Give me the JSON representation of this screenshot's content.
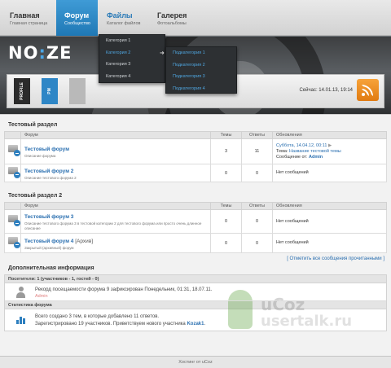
{
  "nav": {
    "items": [
      {
        "title": "Главная",
        "subtitle": "Главная страница"
      },
      {
        "title": "Форум",
        "subtitle": "Сообщество"
      },
      {
        "title": "Файлы",
        "subtitle": "Каталог файлов"
      },
      {
        "title": "Галерея",
        "subtitle": "Фотоальбомы"
      }
    ],
    "categories": [
      "Категория 1",
      "Категория 2",
      "Категория 3",
      "Категория 4"
    ],
    "subcategories": [
      "Подкатегория 1",
      "Подкатегория 2",
      "Подкатегория 3",
      "Подкатегория 4"
    ]
  },
  "header": {
    "logo_left": "NO",
    "logo_mid": ":",
    "logo_right": "ZE",
    "buttons": [
      "PROFILE",
      "PM",
      ""
    ],
    "clock": "Сейчас: 14.01.13, 19:14"
  },
  "forum_sections": [
    {
      "title": "Тестовый раздел",
      "headers": {
        "forum": "Форум",
        "topics": "Темы",
        "replies": "Ответы",
        "updates": "Обновления"
      },
      "rows": [
        {
          "name": "Тестовый форум",
          "desc": "Описание форума",
          "topics": "3",
          "replies": "11",
          "upd_date": "Суббота, 14.04.12, 00:11",
          "upd_topic_label": "Тема:",
          "upd_topic": "Название тестовой темы",
          "upd_by_label": "Сообщение от:",
          "upd_by": "Admin"
        },
        {
          "name": "Тестовый форум 2",
          "desc": "Описание тестового форума 2",
          "topics": "0",
          "replies": "0",
          "no_msgs": "Нет сообщений"
        }
      ]
    },
    {
      "title": "Тестовый раздел 2",
      "headers": {
        "forum": "Форум",
        "topics": "Темы",
        "replies": "Ответы",
        "updates": "Обновления"
      },
      "rows": [
        {
          "name": "Тестовый форум 3",
          "desc": "Описание тестового форума 3 в тестовой категории 2 для тестового форума или просто очень длинное описание",
          "topics": "0",
          "replies": "0",
          "no_msgs": "Нет сообщений"
        },
        {
          "name": "Тестовый форум 4",
          "archive": "[Архив]",
          "desc": "Закрытый (архивный) форум",
          "topics": "0",
          "replies": "0",
          "no_msgs": "Нет сообщений"
        }
      ]
    }
  ],
  "mark_read": "[ Отметить все сообщения прочитанными ]",
  "info": {
    "title": "Дополнительная информация",
    "visitors": "Посетители: 1  (участников - 1, гостей - 0)",
    "record": "Рекорд посещаемости форума 9 зафиксирован Понедельник, 01:31, 18.07.11.",
    "online_user": "Admin",
    "stats_title": "Статистика форума",
    "stats_line1": "Всего создано 3 тем, в которые добавлено 11 ответов.",
    "stats_line2_pre": "Зарегистрировано 19 участников. Приветствуем нового участника",
    "stats_new_user": "Kozak1",
    "stats_line2_post": "."
  },
  "watermark": {
    "top": "uCoz",
    "bottom": "usertalk.ru"
  },
  "footer": "Хостинг от uCoz",
  "colors": {
    "accent": "#2a7ab7",
    "rss": "#f08a1c"
  }
}
